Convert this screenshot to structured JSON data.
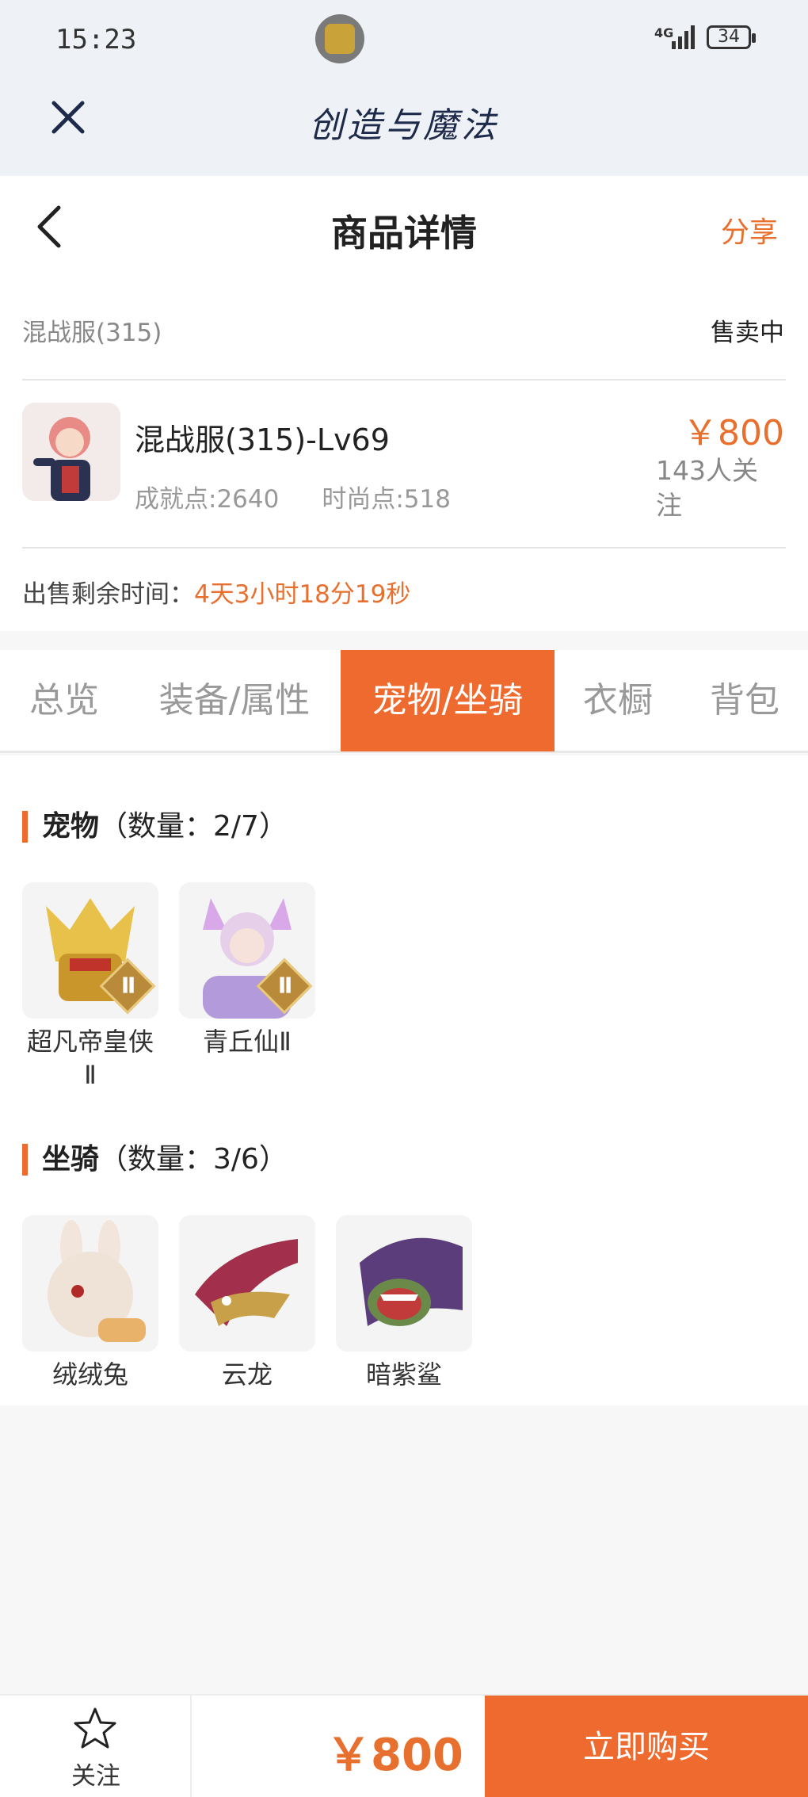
{
  "status_bar": {
    "time": "15:23",
    "network": "4G",
    "battery": "34"
  },
  "app_bar": {
    "title": "创造与魔法"
  },
  "header": {
    "title": "商品详情",
    "share_label": "分享"
  },
  "product": {
    "server": "混战服(315)",
    "status": "售卖中",
    "name": "混战服(315)-Lv69",
    "achievement_points": "成就点:2640",
    "fashion_points": "时尚点:518",
    "price": "￥800",
    "watchers": "143人关注",
    "remaining_label": "出售剩余时间：",
    "remaining_value": "4天3小时18分19秒"
  },
  "tabs": [
    {
      "label": "总览"
    },
    {
      "label": "装备/属性"
    },
    {
      "label": "宠物/坐骑"
    },
    {
      "label": "衣橱"
    },
    {
      "label": "背包"
    }
  ],
  "active_tab": 2,
  "pets": {
    "title": "宠物",
    "count": "（数量：2/7）",
    "items": [
      {
        "name": "超凡帝皇侠Ⅱ",
        "badge": "Ⅱ"
      },
      {
        "name": "青丘仙Ⅱ",
        "badge": "Ⅱ"
      }
    ]
  },
  "mounts": {
    "title": "坐骑",
    "count": "（数量：3/6）",
    "items": [
      {
        "name": "绒绒兔"
      },
      {
        "name": "云龙"
      },
      {
        "name": "暗紫鲨"
      }
    ]
  },
  "bottom_bar": {
    "follow_label": "关注",
    "price": "￥800",
    "buy_label": "立即购买"
  },
  "colors": {
    "accent": "#ef6a2e",
    "price": "#e8702f",
    "title_bar_bg": "#eef2f6"
  }
}
